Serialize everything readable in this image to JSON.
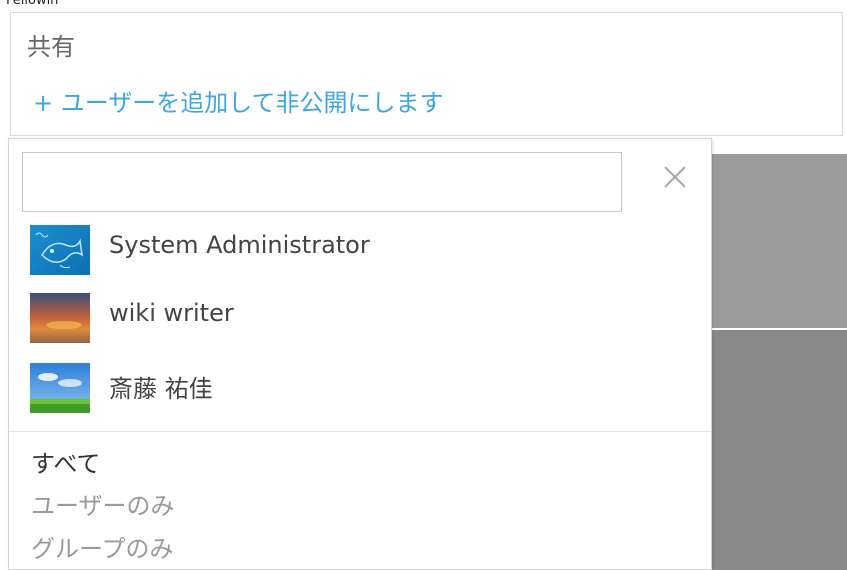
{
  "page": {
    "top_label": "Fellowin"
  },
  "share": {
    "title": "共有",
    "add_link": "+ ユーザーを追加して非公開にします"
  },
  "picker": {
    "search_value": "",
    "search_placeholder": "",
    "users": [
      {
        "name": "System Administrator",
        "avatar": "fish-drawing-avatar"
      },
      {
        "name": "wiki writer",
        "avatar": "sunset-avatar"
      },
      {
        "name": "斎藤 祐佳",
        "avatar": "sky-field-avatar"
      }
    ],
    "filters": [
      {
        "label": "すべて",
        "selected": true
      },
      {
        "label": "ユーザーのみ",
        "selected": false
      },
      {
        "label": "グループのみ",
        "selected": false
      }
    ]
  },
  "colors": {
    "link": "#3ea8dc",
    "selected_filter": "#333333",
    "unselected_filter": "#9a9a9a"
  }
}
